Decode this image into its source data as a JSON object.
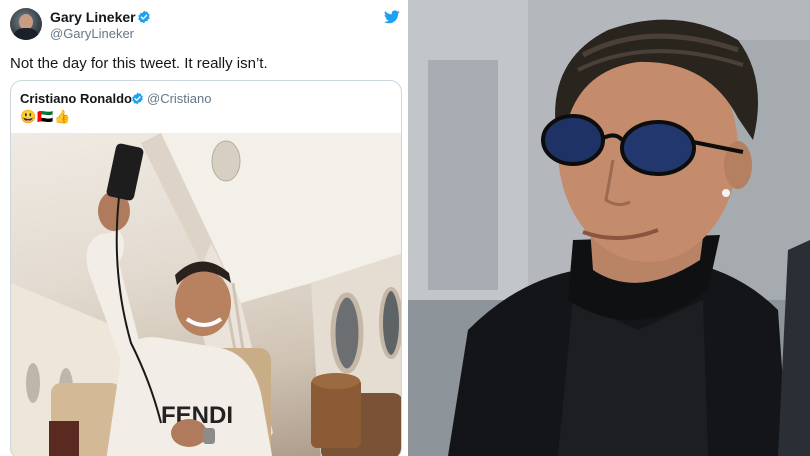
{
  "tweet": {
    "display_name": "Gary Lineker",
    "handle": "@GaryLineker",
    "text": "Not the day for this tweet. It really isn’t.",
    "brand_color": "#1da1f2"
  },
  "quoted_tweet": {
    "display_name": "Cristiano Ronaldo",
    "handle": "@Cristiano",
    "emoji": "😃🇦🇪👍"
  },
  "icons": {
    "verified": "verified-badge-icon",
    "platform": "twitter-bird-icon"
  }
}
